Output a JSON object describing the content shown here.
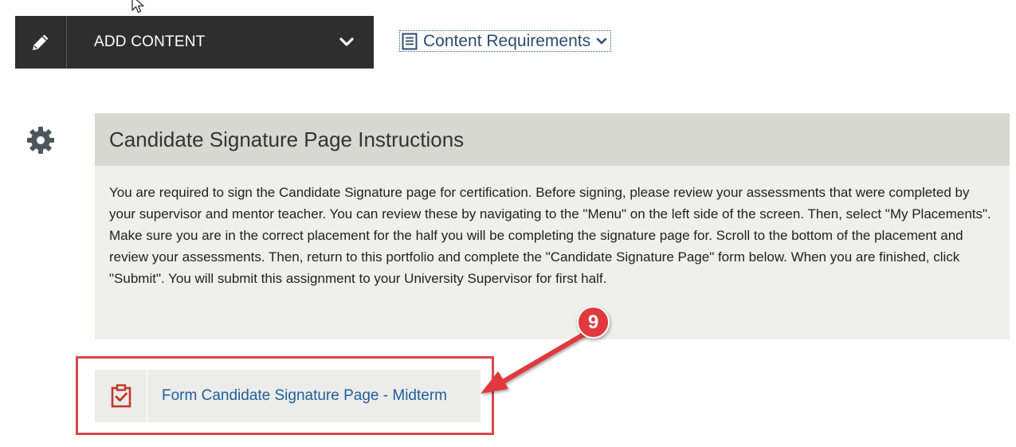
{
  "toolbar": {
    "add_content_label": "ADD CONTENT",
    "content_requirements_label": "Content Requirements"
  },
  "section": {
    "title": "Candidate Signature Page Instructions",
    "instructions": "You are required to sign the Candidate Signature page for certification.  Before signing, please review your assessments that were completed by your supervisor and mentor teacher. You can review these by navigating to the \"Menu\" on the left side of the screen. Then, select \"My Placements\".  Make sure you are in the correct placement for the half you will be completing the signature page for. Scroll to the bottom of the placement and review your assessments.  Then, return to this portfolio and complete the \"Candidate Signature Page\" form below. When you are finished, click \"Submit\".  You will submit this assignment to your University Supervisor for first half."
  },
  "form_item": {
    "label": "Form Candidate Signature Page - Midterm"
  },
  "annotation": {
    "step_number": "9",
    "color": "#e0393e"
  },
  "icons": [
    "cursor-icon",
    "pencil-icon",
    "chevron-down-icon",
    "document-list-icon",
    "gear-icon",
    "clipboard-check-icon"
  ]
}
